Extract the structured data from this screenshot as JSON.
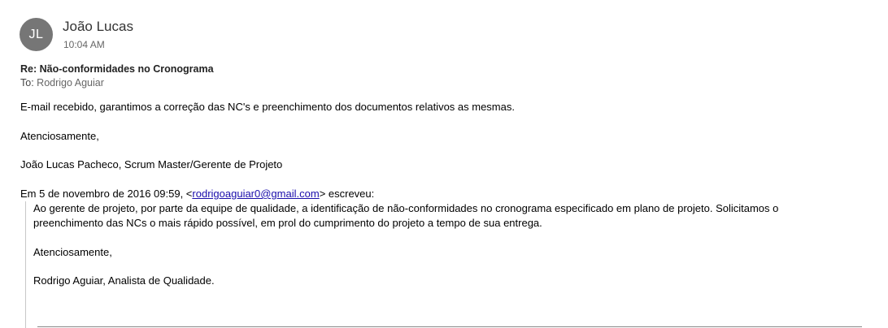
{
  "sender": {
    "initials": "JL",
    "name": "João Lucas",
    "time": "10:04 AM"
  },
  "message": {
    "subject": "Re: Não-conformidades no Cronograma",
    "to_label": "To:",
    "to_name": "Rodrigo Aguiar",
    "body_line_1": "E-mail recebido, garantimos a correção das NC's e preenchimento dos documentos relativos as mesmas.",
    "body_line_2": "Atenciosamente,",
    "body_line_3": "João Lucas Pacheco, Scrum Master/Gerente de Projeto",
    "quote_header_prefix": "Em 5 de novembro de 2016 09:59, <",
    "quote_header_email": "rodrigoaguiar0@gmail.com",
    "quote_header_suffix": "> escreveu:"
  },
  "quoted": {
    "line_1": "Ao gerente de projeto, por parte da equipe de qualidade, a identificação de não-conformidades no cronograma especificado em plano de projeto. Solicitamos o",
    "line_2": "preenchimento das NCs o mais rápido possível, em prol do cumprimento do projeto a tempo de sua entrega.",
    "line_3": "Atenciosamente,",
    "line_4": "Rodrigo Aguiar, Analista de Qualidade."
  },
  "colors": {
    "avatar_bg": "#767676",
    "link": "#1a0dab",
    "quote_border": "#c8c8c8"
  }
}
